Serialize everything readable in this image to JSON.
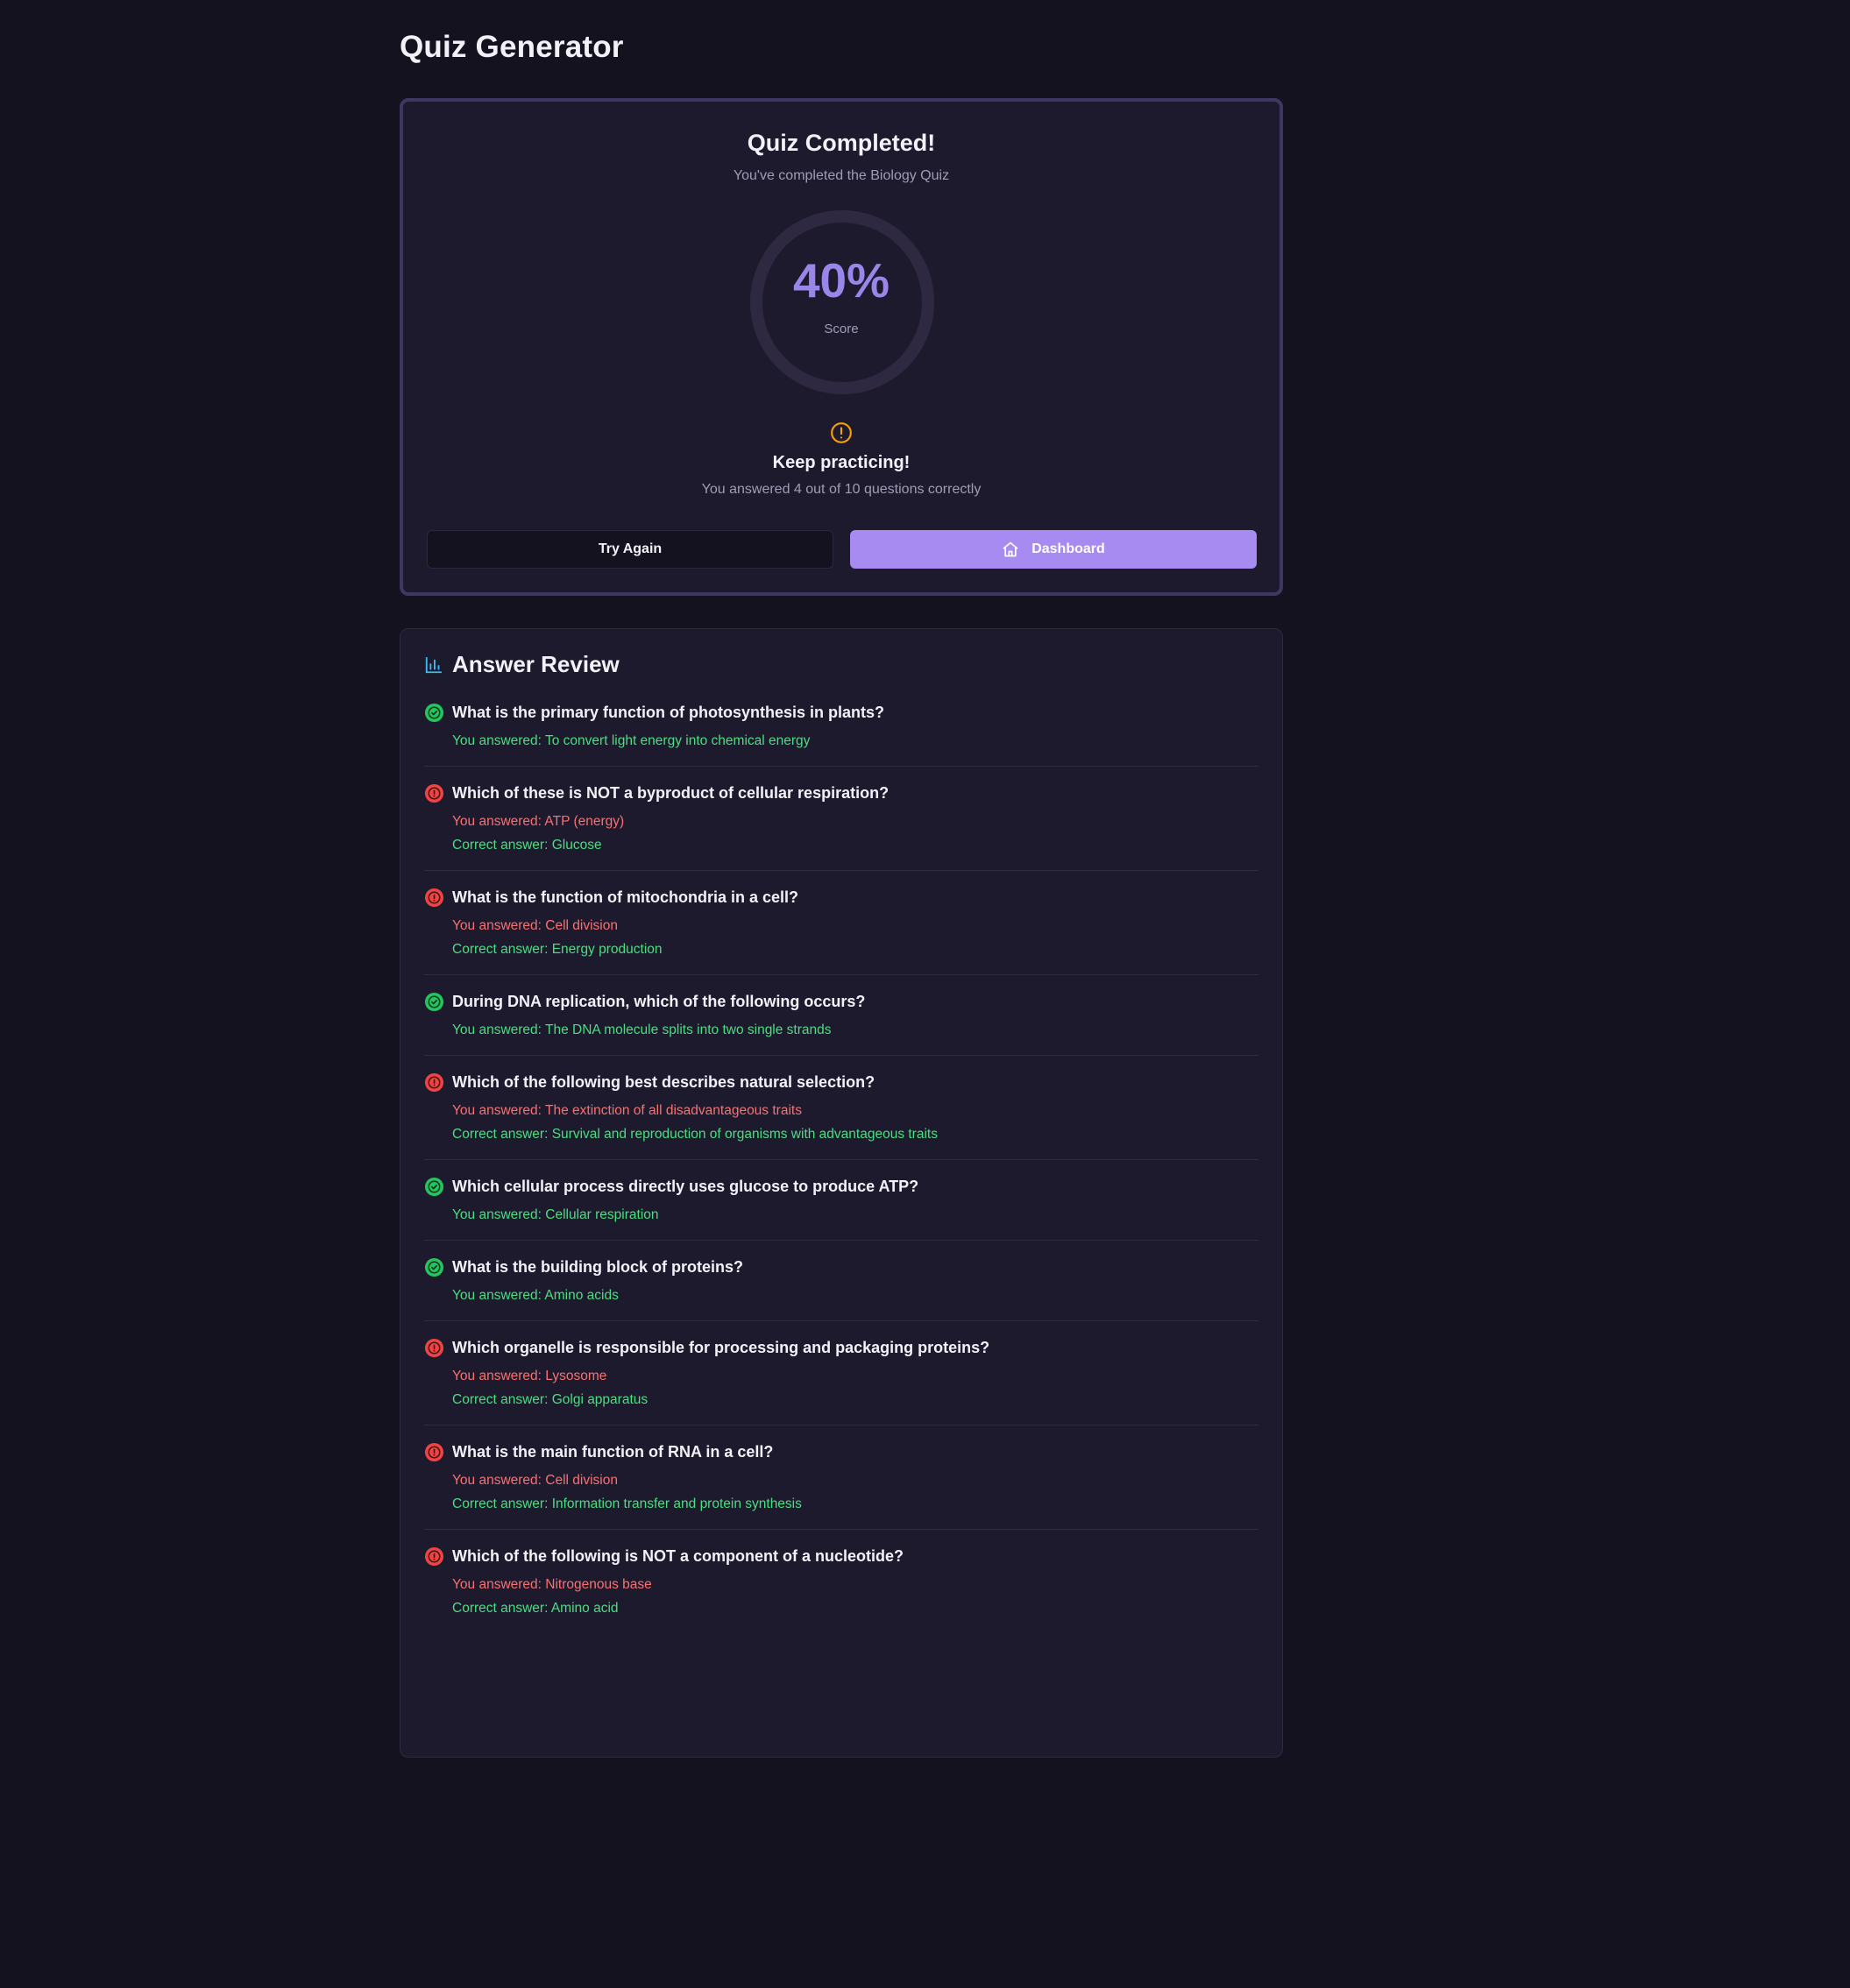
{
  "app": {
    "title": "Quiz Generator"
  },
  "results": {
    "title": "Quiz Completed!",
    "subtitle": "You've completed the Biology Quiz",
    "score_text": "40%",
    "score_fraction": 0.4,
    "score_label": "Score",
    "feedback_title": "Keep practicing!",
    "feedback_text": "You answered 4 out of 10 questions correctly",
    "try_again_label": "Try Again",
    "dashboard_label": "Dashboard"
  },
  "review": {
    "title": "Answer Review",
    "items": [
      {
        "status": "correct",
        "question": "What is the primary function of photosynthesis in plants?",
        "your_answer": "You answered: To convert light energy into chemical energy"
      },
      {
        "status": "incorrect",
        "question": "Which of these is NOT a byproduct of cellular respiration?",
        "your_answer": "You answered: ATP (energy)",
        "correct_answer": "Correct answer: Glucose"
      },
      {
        "status": "incorrect",
        "question": "What is the function of mitochondria in a cell?",
        "your_answer": "You answered: Cell division",
        "correct_answer": "Correct answer: Energy production"
      },
      {
        "status": "correct",
        "question": "During DNA replication, which of the following occurs?",
        "your_answer": "You answered: The DNA molecule splits into two single strands"
      },
      {
        "status": "incorrect",
        "question": "Which of the following best describes natural selection?",
        "your_answer": "You answered: The extinction of all disadvantageous traits",
        "correct_answer": "Correct answer: Survival and reproduction of organisms with advantageous traits"
      },
      {
        "status": "correct",
        "question": "Which cellular process directly uses glucose to produce ATP?",
        "your_answer": "You answered: Cellular respiration"
      },
      {
        "status": "correct",
        "question": "What is the building block of proteins?",
        "your_answer": "You answered: Amino acids"
      },
      {
        "status": "incorrect",
        "question": "Which organelle is responsible for processing and packaging proteins?",
        "your_answer": "You answered: Lysosome",
        "correct_answer": "Correct answer: Golgi apparatus"
      },
      {
        "status": "incorrect",
        "question": "What is the main function of RNA in a cell?",
        "your_answer": "You answered: Cell division",
        "correct_answer": "Correct answer: Information transfer and protein synthesis"
      },
      {
        "status": "incorrect",
        "question": "Which of the following is NOT a component of a nucleotide?",
        "your_answer": "You answered: Nitrogenous base",
        "correct_answer": "Correct answer: Amino acid"
      }
    ]
  },
  "icons": {
    "alert": "alert-circle-icon",
    "home": "home-icon",
    "chart": "bar-chart-icon",
    "correct": "check-circle-icon",
    "incorrect": "alert-circle-icon"
  },
  "colors": {
    "accent": "#a78bf0",
    "score": "#9a85e8",
    "correct": "#4ade80",
    "incorrect": "#f87171",
    "warning": "#f59e0b",
    "chart_icon": "#38bdf8"
  }
}
